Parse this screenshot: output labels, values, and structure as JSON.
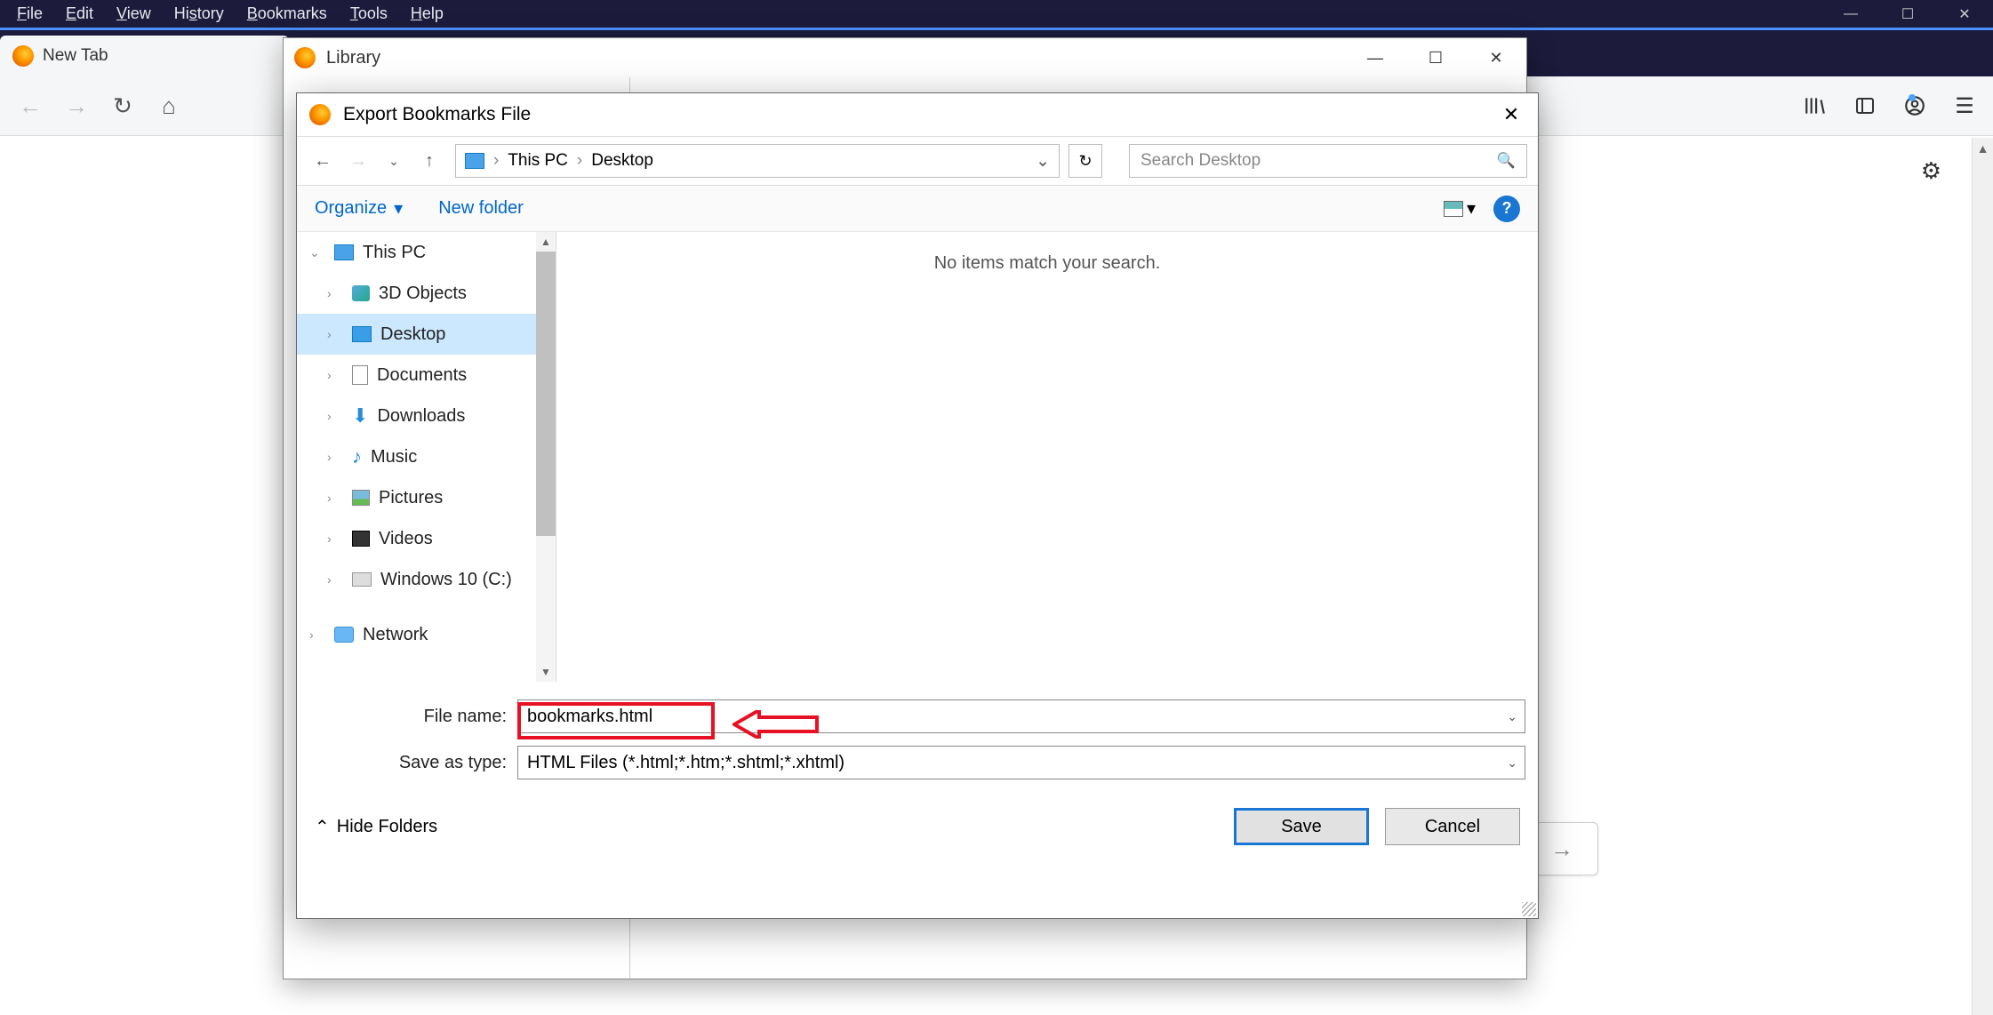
{
  "menubar": [
    "File",
    "Edit",
    "View",
    "History",
    "Bookmarks",
    "Tools",
    "Help"
  ],
  "tab": {
    "title": "New Tab"
  },
  "library": {
    "title": "Library"
  },
  "dialog": {
    "title": "Export Bookmarks File",
    "breadcrumb": [
      "This PC",
      "Desktop"
    ],
    "search_placeholder": "Search Desktop",
    "organize": "Organize",
    "new_folder": "New folder",
    "empty_text": "No items match your search.",
    "tree": {
      "this_pc": "This PC",
      "items": [
        "3D Objects",
        "Desktop",
        "Documents",
        "Downloads",
        "Music",
        "Pictures",
        "Videos",
        "Windows 10 (C:)"
      ],
      "network": "Network"
    },
    "file_name_label": "File name:",
    "file_name_value": "bookmarks.html",
    "save_type_label": "Save as type:",
    "save_type_value": "HTML Files (*.html;*.htm;*.shtml;*.xhtml)",
    "hide_folders": "Hide Folders",
    "save": "Save",
    "cancel": "Cancel"
  }
}
